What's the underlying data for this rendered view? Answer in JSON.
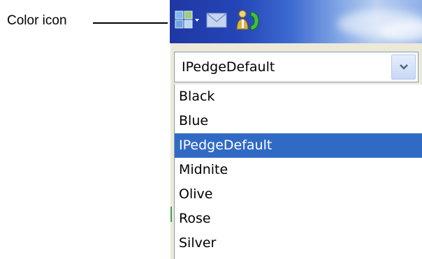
{
  "callout": {
    "label": "Color icon"
  },
  "toolbar": {
    "buttons": [
      {
        "icon": "color-scheme-icon",
        "has_dropdown": true
      },
      {
        "icon": "mail-icon"
      },
      {
        "icon": "phone-user-icon"
      }
    ]
  },
  "color_combo": {
    "selected": "IPedgeDefault",
    "options": [
      "Black",
      "Blue",
      "IPedgeDefault",
      "Midnite",
      "Olive",
      "Rose",
      "Silver"
    ],
    "highlighted_index": 2
  },
  "colors": {
    "selection_bg": "#316ac5",
    "titlebar": "#2546b8"
  }
}
